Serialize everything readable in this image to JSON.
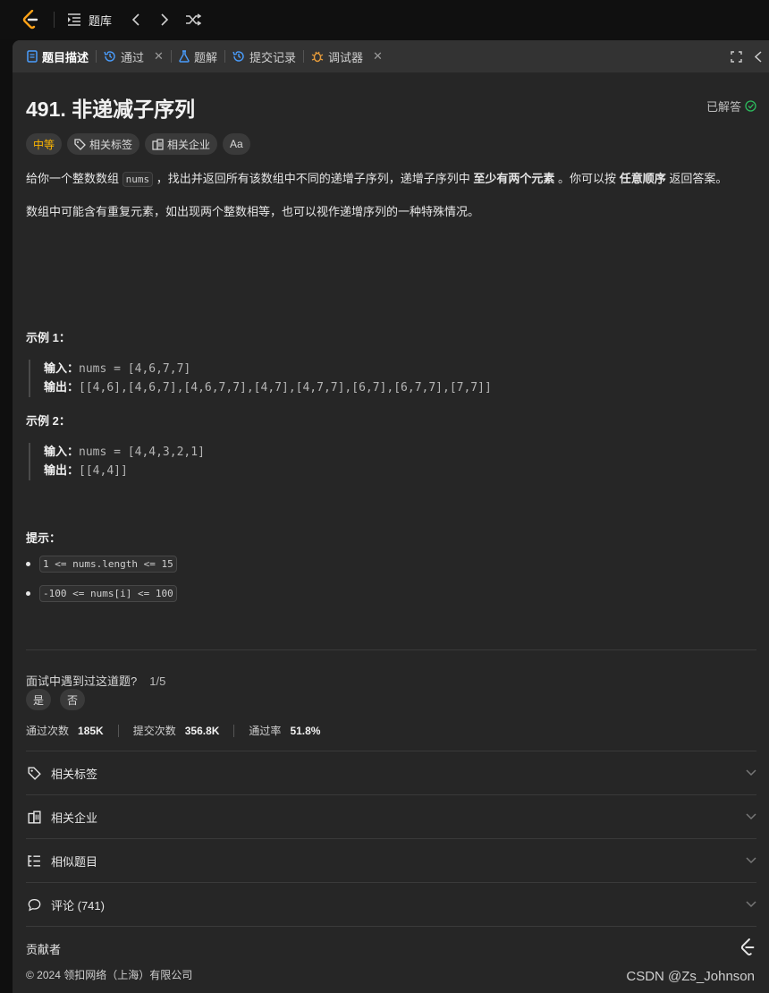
{
  "topbar": {
    "library_label": "题库"
  },
  "tabs": [
    {
      "label": "题目描述",
      "active": true
    },
    {
      "label": "通过",
      "closable": true
    },
    {
      "label": "题解"
    },
    {
      "label": "提交记录"
    },
    {
      "label": "调试器",
      "closable": true
    }
  ],
  "problem": {
    "title": "491. 非递减子序列",
    "status": "已解答",
    "difficulty": "中等",
    "chip_tags": "相关标签",
    "chip_companies": "相关企业",
    "chip_translate": "Aa"
  },
  "description": {
    "p1_a": "给你一个整数数组",
    "p1_code": "nums",
    "p1_b": "，找出并返回所有该数组中不同的递增子序列，递增子序列中",
    "p1_bold1": "至少有两个元素",
    "p1_c": "。你可以按",
    "p1_bold2": "任意顺序",
    "p1_d": "返回答案。",
    "p2": "数组中可能含有重复元素，如出现两个整数相等，也可以视作递增序列的一种特殊情况。"
  },
  "examples": [
    {
      "title": "示例 1：",
      "input_label": "输入：",
      "input": "nums = [4,6,7,7]",
      "output_label": "输出：",
      "output": "[[4,6],[4,6,7],[4,6,7,7],[4,7],[4,7,7],[6,7],[6,7,7],[7,7]]"
    },
    {
      "title": "示例 2：",
      "input_label": "输入：",
      "input": "nums = [4,4,3,2,1]",
      "output_label": "输出：",
      "output": "[[4,4]]"
    }
  ],
  "hints": {
    "title": "提示：",
    "items": [
      "1 <= nums.length <= 15",
      "-100 <= nums[i] <= 100"
    ]
  },
  "meet": {
    "question": "面试中遇到过这道题?",
    "fraction": "1/5",
    "yes": "是",
    "no": "否"
  },
  "stats": {
    "accepted_label": "通过次数",
    "accepted": "185K",
    "submissions_label": "提交次数",
    "submissions": "356.8K",
    "rate_label": "通过率",
    "rate": "51.8%"
  },
  "accordion": {
    "tags": "相关标签",
    "companies": "相关企业",
    "similar": "相似题目",
    "comments": "评论 (741)",
    "contributors": "贡献者"
  },
  "footer": {
    "copyright": "© 2024 领扣网络（上海）有限公司"
  },
  "watermark": "CSDN @Zs_Johnson",
  "colors": {
    "accent": "#ffb700",
    "panel": "#262626",
    "tabbar": "#333333",
    "success": "#2cbb5d"
  }
}
